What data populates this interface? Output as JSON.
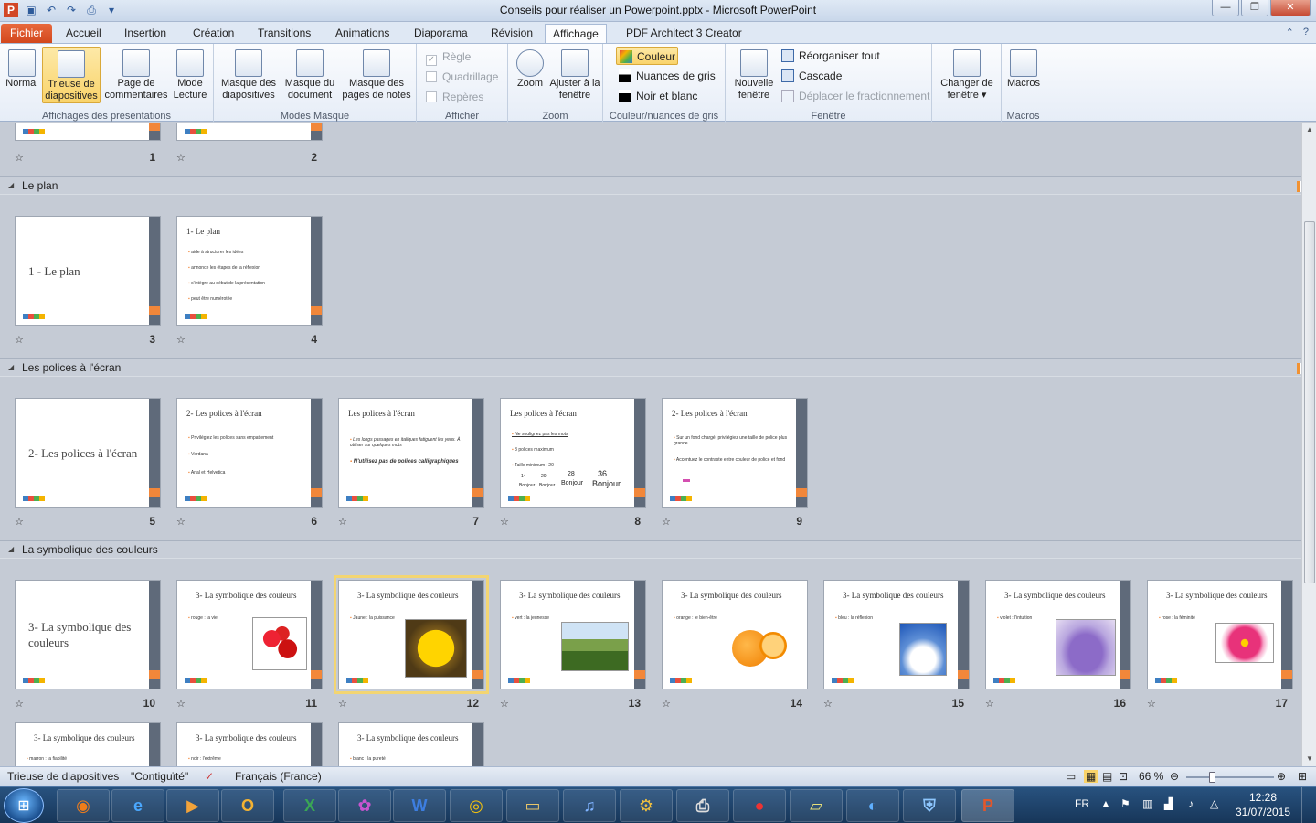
{
  "window": {
    "title": "Conseils pour réaliser un Powerpoint.pptx - Microsoft PowerPoint"
  },
  "tabs": [
    {
      "label": "Fichier"
    },
    {
      "label": "Accueil"
    },
    {
      "label": "Insertion"
    },
    {
      "label": "Création"
    },
    {
      "label": "Transitions"
    },
    {
      "label": "Animations"
    },
    {
      "label": "Diaporama"
    },
    {
      "label": "Révision"
    },
    {
      "label": "Affichage"
    },
    {
      "label": "PDF Architect 3 Creator"
    }
  ],
  "active_tab": "Affichage",
  "ribbon": {
    "views": {
      "label": "Affichages des présentations",
      "normal": "Normal",
      "sorter": "Trieuse de diapositives",
      "notes": "Page de commentaires",
      "reading": "Mode Lecture"
    },
    "masters": {
      "label": "Modes Masque",
      "slide": "Masque des diapositives",
      "handout": "Masque du document",
      "notes": "Masque des pages de notes"
    },
    "show": {
      "label": "Afficher",
      "ruler": "Règle",
      "grid": "Quadrillage",
      "guides": "Repères"
    },
    "zoom": {
      "label": "Zoom",
      "zoom": "Zoom",
      "fit": "Ajuster à la fenêtre"
    },
    "color": {
      "label": "Couleur/nuances de gris",
      "color": "Couleur",
      "gray": "Nuances de gris",
      "bw": "Noir et blanc"
    },
    "window": {
      "label": "Fenêtre",
      "new": "Nouvelle fenêtre",
      "arrange": "Réorganiser tout",
      "cascade": "Cascade",
      "split": "Déplacer le fractionnement",
      "switch": "Changer de fenêtre"
    },
    "macros": {
      "label": "Macros",
      "macros": "Macros"
    }
  },
  "sections": [
    {
      "name": "Le plan"
    },
    {
      "name": "Les polices à l'écran"
    },
    {
      "name": "La symbolique des couleurs"
    }
  ],
  "slides": {
    "s3": {
      "num": "3",
      "title": "1 - Le plan"
    },
    "s4": {
      "num": "4",
      "title": "1- Le plan",
      "bullets": [
        "aide à structurer les idées",
        "annonce les étapes de la réflexion",
        "s'intègre au début de la présentation",
        "peut être numérotée"
      ]
    },
    "s5": {
      "num": "5",
      "title": "2- Les polices à l'écran"
    },
    "s6": {
      "num": "6",
      "title": "2- Les polices à l'écran",
      "bullets": [
        "Privilégiez les polices sans empattement",
        "Verdana",
        "Arial et Helvetica"
      ]
    },
    "s7": {
      "num": "7",
      "title": "Les polices à l'écran",
      "bullets": [
        "Les longs passages en italiques fatiguent les yeux. À utiliser sur quelques mots",
        "N'utilisez pas de polices calligraphiques"
      ]
    },
    "s8": {
      "num": "8",
      "title": "Les polices à l'écran",
      "bullets": [
        "Ne soulignez pas les mots",
        "3 polices maximum",
        "Taille minimum : 20"
      ],
      "sizes": [
        "14",
        "20",
        "28",
        "36"
      ],
      "sample": "Bonjour"
    },
    "s9": {
      "num": "9",
      "title": "2- Les polices à l'écran",
      "bullets": [
        "Sur un fond chargé, privilégiez une taille de police plus grande",
        "Accentuez le contraste entre couleur de police et fond"
      ]
    },
    "s10": {
      "num": "10",
      "title": "3- La symbolique des couleurs"
    },
    "s11": {
      "num": "11",
      "title": "3- La symbolique des couleurs",
      "bullet": "rouge : la vie"
    },
    "s12": {
      "num": "12",
      "title": "3- La symbolique des couleurs",
      "bullet": "Jaune : la puissance"
    },
    "s13": {
      "num": "13",
      "title": "3- La symbolique des couleurs",
      "bullet": "vert : la jeunesse"
    },
    "s14": {
      "num": "14",
      "title": "3- La symbolique des couleurs",
      "bullet": "orange : le bien-être"
    },
    "s15": {
      "num": "15",
      "title": "3- La symbolique des couleurs",
      "bullet": "bleu : la réflexion"
    },
    "s16": {
      "num": "16",
      "title": "3- La symbolique des couleurs",
      "bullet": "violet : l'intuition"
    },
    "s17": {
      "num": "17",
      "title": "3- La symbolique des couleurs",
      "bullet": "rose : la féminité"
    },
    "s18": {
      "title": "3- La symbolique des couleurs",
      "bullet": "marron : la fiabilité"
    },
    "s19": {
      "title": "3- La symbolique des couleurs",
      "bullet": "noir : l'extrême"
    },
    "s20": {
      "title": "3- La symbolique des couleurs",
      "bullet": "blanc : la pureté"
    },
    "s1": {
      "num": "1"
    },
    "s2": {
      "num": "2"
    }
  },
  "status": {
    "view": "Trieuse de diapositives",
    "theme": "\"Contiguïté\"",
    "language": "Français (France)",
    "zoom": "66 %"
  },
  "taskbar": {
    "lang": "FR",
    "time": "12:28",
    "date": "31/07/2015"
  },
  "colors": {
    "accent": "#f2873a",
    "slidebar": "#5f6a7a",
    "file_tab": "#d2461c"
  }
}
